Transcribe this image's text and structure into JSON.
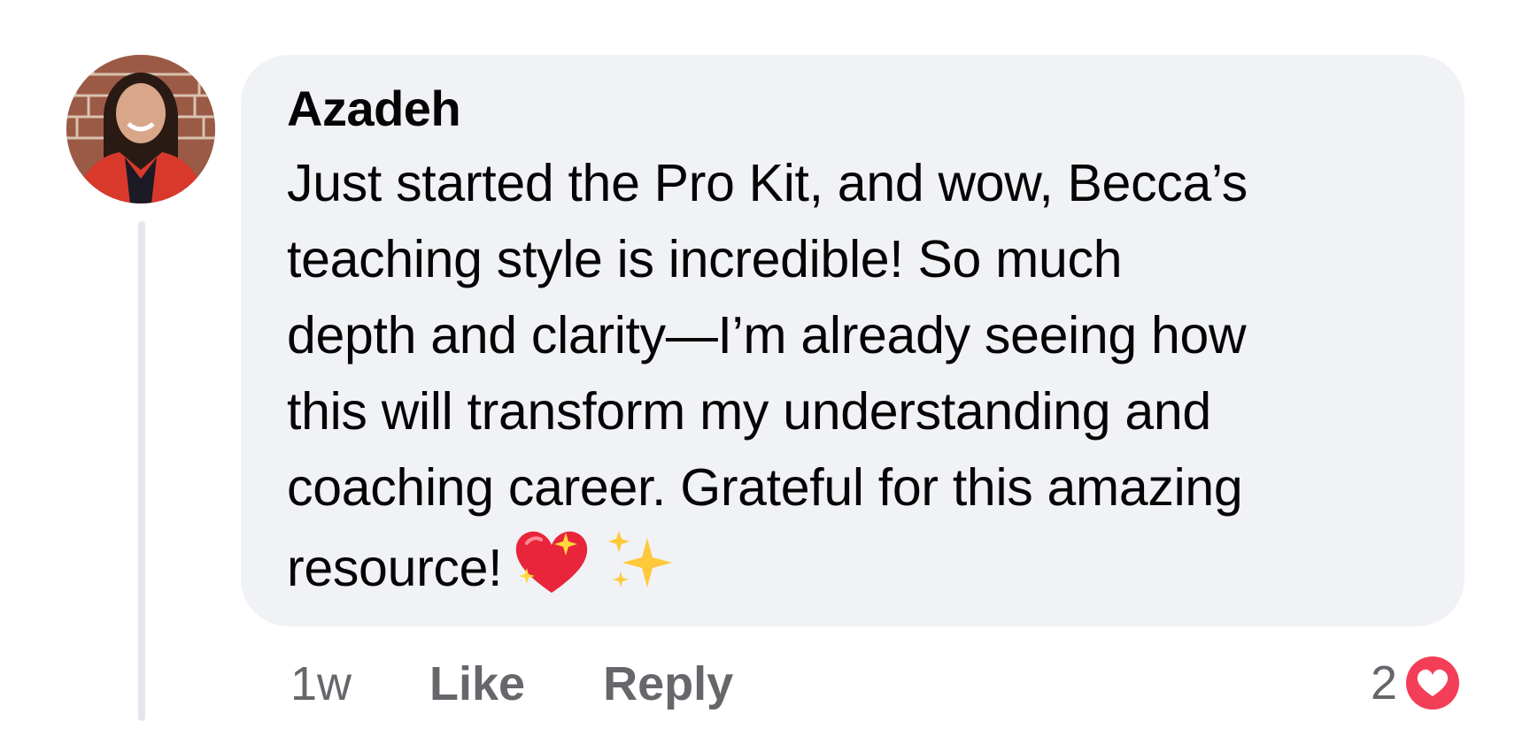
{
  "comment": {
    "author": "Azadeh",
    "lines": [
      "Just started the Pro Kit, and wow, Becca’s",
      "teaching style is incredible! So much",
      "depth and clarity—I’m already seeing how",
      "this will transform my understanding and",
      "coaching career. Grateful for this amazing",
      "resource!"
    ],
    "emojis": [
      "sparkling-heart",
      "sparkles"
    ],
    "avatar_icon": "profile-photo"
  },
  "actions": {
    "timestamp": "1w",
    "like_label": "Like",
    "reply_label": "Reply"
  },
  "reactions": {
    "count": "2",
    "icon": "love-reaction-icon",
    "color": "#f33e58"
  },
  "colors": {
    "bubble": "#f0f2f5",
    "text": "#050505",
    "secondary_text": "#65676b",
    "thread_line": "#e4e6eb"
  }
}
